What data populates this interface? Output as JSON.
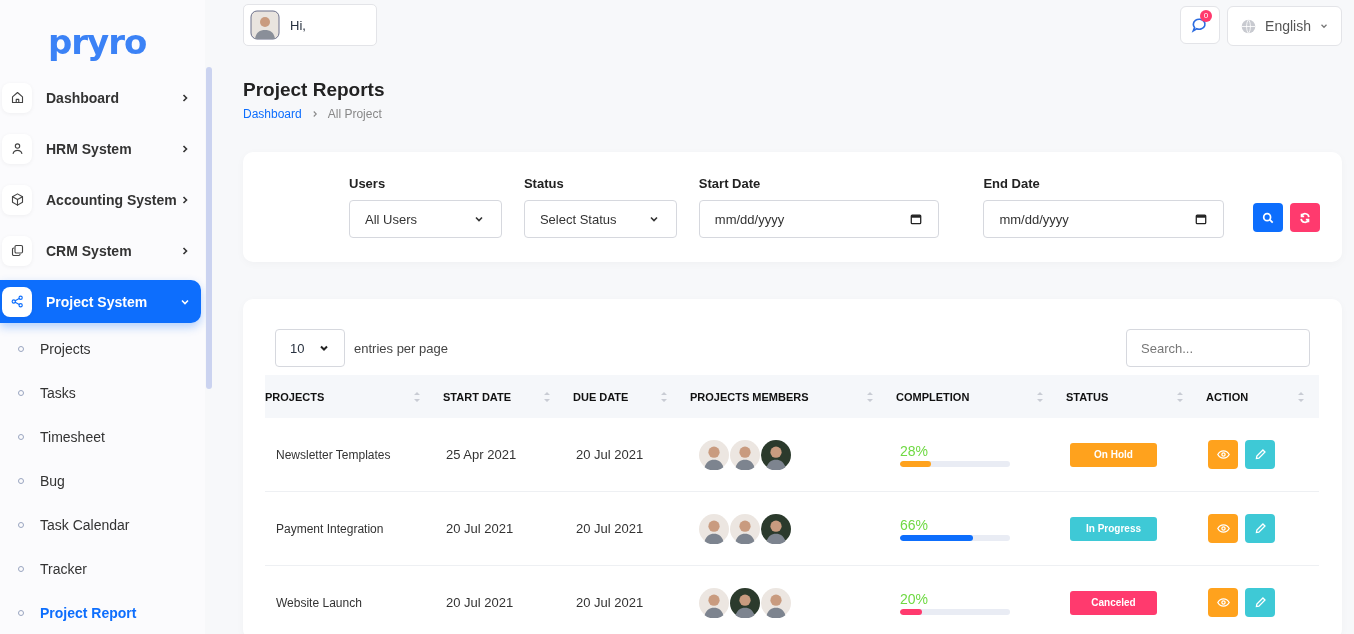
{
  "brand": {
    "logo": "pryro"
  },
  "sidebar": {
    "items": [
      {
        "label": "Dashboard",
        "expanded": false,
        "selected": false
      },
      {
        "label": "HRM System",
        "expanded": false,
        "selected": false
      },
      {
        "label": "Accounting System",
        "expanded": false,
        "selected": false
      },
      {
        "label": "CRM System",
        "expanded": false,
        "selected": false
      },
      {
        "label": "Project System",
        "expanded": true,
        "selected": true,
        "children": [
          {
            "label": "Projects",
            "selected": false
          },
          {
            "label": "Tasks",
            "selected": false
          },
          {
            "label": "Timesheet",
            "selected": false
          },
          {
            "label": "Bug",
            "selected": false
          },
          {
            "label": "Task Calendar",
            "selected": false
          },
          {
            "label": "Tracker",
            "selected": false
          },
          {
            "label": "Project Report",
            "selected": true
          }
        ]
      }
    ]
  },
  "header": {
    "greeting": "Hi,",
    "notifications": "0",
    "language": "English"
  },
  "page": {
    "title": "Project Reports",
    "breadcrumb": [
      "Dashboard",
      "All Project"
    ]
  },
  "filters": [
    {
      "kind": "select",
      "label": "Users",
      "value": "All Users"
    },
    {
      "kind": "select",
      "label": "Status",
      "value": "Select Status"
    },
    {
      "kind": "date",
      "label": "Start Date",
      "placeholder": "mm/dd/yyyy"
    },
    {
      "kind": "date",
      "label": "End Date",
      "placeholder": "mm/dd/yyyy"
    }
  ],
  "table": {
    "page_size": "10",
    "page_size_label": "entries per page",
    "search": {
      "placeholder": "Search..."
    },
    "columns": [
      "PROJECTS",
      "START DATE",
      "DUE DATE",
      "PROJECTS MEMBERS",
      "COMPLETION",
      "STATUS",
      "ACTION"
    ],
    "rows": [
      {
        "project": "Newsletter Templates",
        "start": "25 Apr 2021",
        "due": "20 Jul 2021",
        "members": [
          {
            "color": "#ece6e1"
          },
          {
            "color": "#ece6e1"
          },
          {
            "color": "#2b3a2c"
          }
        ],
        "completion": "28%",
        "progress": {
          "level": 0.28,
          "color": "#ffa21d"
        },
        "status": {
          "label": "On Hold",
          "color": "#ffa21d"
        }
      },
      {
        "project": "Payment Integration",
        "start": "20 Jul 2021",
        "due": "20 Jul 2021",
        "members": [
          {
            "color": "#ece6e1"
          },
          {
            "color": "#ece6e1"
          },
          {
            "color": "#2b3a2c"
          }
        ],
        "completion": "66%",
        "progress": {
          "level": 0.66,
          "color": "#0d6efd"
        },
        "status": {
          "label": "In Progress",
          "color": "#3ec9d6"
        }
      },
      {
        "project": "Website Launch",
        "start": "20 Jul 2021",
        "due": "20 Jul 2021",
        "members": [
          {
            "color": "#ece6e1"
          },
          {
            "color": "#2b3a2c"
          },
          {
            "color": "#ece6e1"
          }
        ],
        "completion": "20%",
        "progress": {
          "level": 0.2,
          "color": "#ff3a6e"
        },
        "status": {
          "label": "Canceled",
          "color": "#ff3a6e"
        }
      }
    ]
  }
}
